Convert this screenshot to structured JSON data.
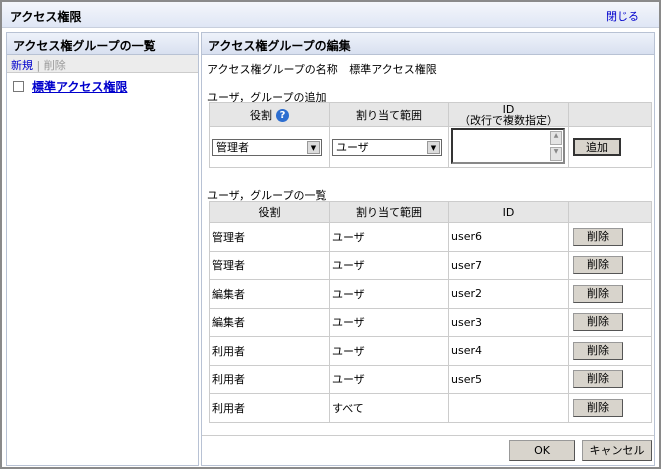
{
  "window": {
    "title": "アクセス権限",
    "close_label": "閉じる"
  },
  "left": {
    "title": "アクセス権グループの一覧",
    "new_label": "新規",
    "separator": "|",
    "delete_label": "削除",
    "groups": [
      {
        "name": "標準アクセス権限",
        "checked": false
      }
    ]
  },
  "right": {
    "title": "アクセス権グループの編集",
    "name_label": "アクセス権グループの名称",
    "name_value": "標準アクセス権限",
    "add_section": {
      "title": "ユーザ，グループの追加",
      "col_role": "役割",
      "col_scope": "割り当て範囲",
      "col_id": "ID",
      "col_id_note": "（改行で複数指定）",
      "role_value": "管理者",
      "scope_value": "ユーザ",
      "id_value": "",
      "add_button": "追加"
    },
    "list_section": {
      "title": "ユーザ，グループの一覧",
      "col_role": "役割",
      "col_scope": "割り当て範囲",
      "col_id": "ID",
      "delete_label": "削除",
      "rows": [
        {
          "role": "管理者",
          "scope": "ユーザ",
          "id": "user6"
        },
        {
          "role": "管理者",
          "scope": "ユーザ",
          "id": "user7"
        },
        {
          "role": "編集者",
          "scope": "ユーザ",
          "id": "user2"
        },
        {
          "role": "編集者",
          "scope": "ユーザ",
          "id": "user3"
        },
        {
          "role": "利用者",
          "scope": "ユーザ",
          "id": "user4"
        },
        {
          "role": "利用者",
          "scope": "ユーザ",
          "id": "user5"
        },
        {
          "role": "利用者",
          "scope": "すべて",
          "id": ""
        }
      ]
    },
    "ok_label": "OK",
    "cancel_label": "キャンセル"
  },
  "colors": {
    "link": "#0000cc",
    "header_bg": "#dfe6f5",
    "help_icon": "#2d6ed0"
  }
}
